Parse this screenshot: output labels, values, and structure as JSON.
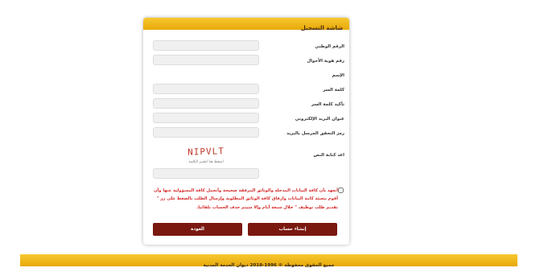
{
  "form": {
    "title": "شاشة التسجيل",
    "fields": [
      {
        "label": "الرقم الوطني",
        "value": ""
      },
      {
        "label": "رقم هوية الأحوال",
        "value": ""
      },
      {
        "label": "الإسم"
      },
      {
        "label": "كلمة السر",
        "value": ""
      },
      {
        "label": "تأكيد كلمة السر",
        "value": ""
      },
      {
        "label": "عنوان البريد الإلكتروني",
        "value": ""
      },
      {
        "label": "رمز التحقق المرسل بالبريد",
        "value": ""
      }
    ],
    "captcha": {
      "label": "اعد كتابة النص",
      "text": "NIPVLT",
      "hint": "اضغط هنا لتغيير الكلمة",
      "value": ""
    },
    "pledge": {
      "checked": false,
      "text": "أتعهد بأن كافة البيانات المدخلة والوثائق المرفقة صحيحة وأتحمل كافة المسؤولية عنها وأن أقوم بتعبئة كامة البيانات وارفاق كافة الوثائق المطلوبة وإرسال الطلب بالضغط على زر \" تقديم طلب توظيف \" خلال سبعة أيام وإلا سيتم حذف الحساب تلقائيا."
    },
    "buttons": {
      "create": "إنشاء حساب",
      "back": "العودة"
    }
  },
  "footer": {
    "text": "جميع الحقوق محفوظة © 1996-2018 ديوان الخدمة المدنية"
  },
  "colors": {
    "header_accent": "#f0b81a",
    "button_bg": "#7a1810",
    "pledge_text": "#d42b2b",
    "captcha_text": "#c0392b"
  }
}
